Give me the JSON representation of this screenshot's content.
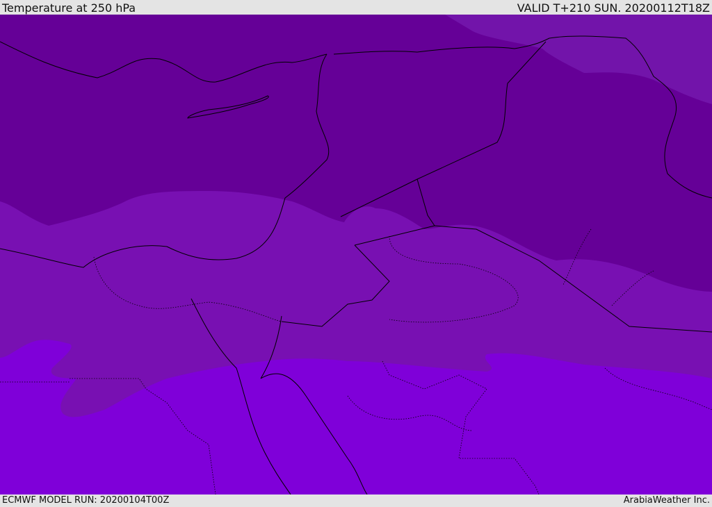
{
  "header": {
    "title": "Temperature at 250 hPa",
    "valid": "VALID T+210 SUN. 20200112T18Z"
  },
  "footer": {
    "model_run": "ECMWF MODEL RUN: 20200104T00Z",
    "credit": "ArabiaWeather Inc."
  },
  "colors": {
    "cold_band": "#650097",
    "mid_band": "#7810b2",
    "warm_band": "#7f00d9",
    "northeast_band": "#7214aa",
    "background": "#e4e4e4"
  }
}
